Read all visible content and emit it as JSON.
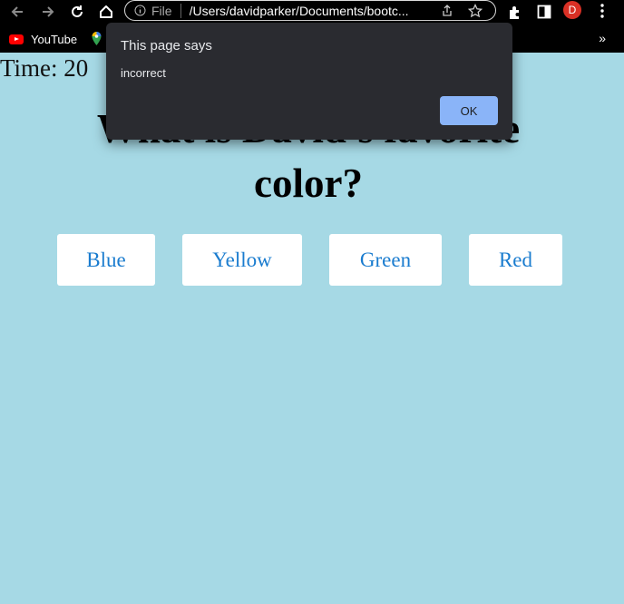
{
  "browser": {
    "file_label": "File",
    "url": "/Users/davidparker/Documents/bootc...",
    "profile_initial": "D",
    "colors": {
      "profile": "#d93025",
      "youtube": "#ff0000"
    },
    "bookmarks": [
      {
        "label": "YouTube"
      }
    ],
    "overflow": "»"
  },
  "page": {
    "timer": "Time: 20",
    "question": "What is David's favorite color?",
    "answers": [
      "Blue",
      "Yellow",
      "Green",
      "Red"
    ],
    "colors": {
      "background": "#a6d9e5",
      "answer_text": "#1a7ccf"
    }
  },
  "dialog": {
    "title": "This page says",
    "message": "incorrect",
    "ok_label": "OK",
    "colors": {
      "background": "#2a2b30",
      "ok": "#8ab4f8"
    }
  }
}
